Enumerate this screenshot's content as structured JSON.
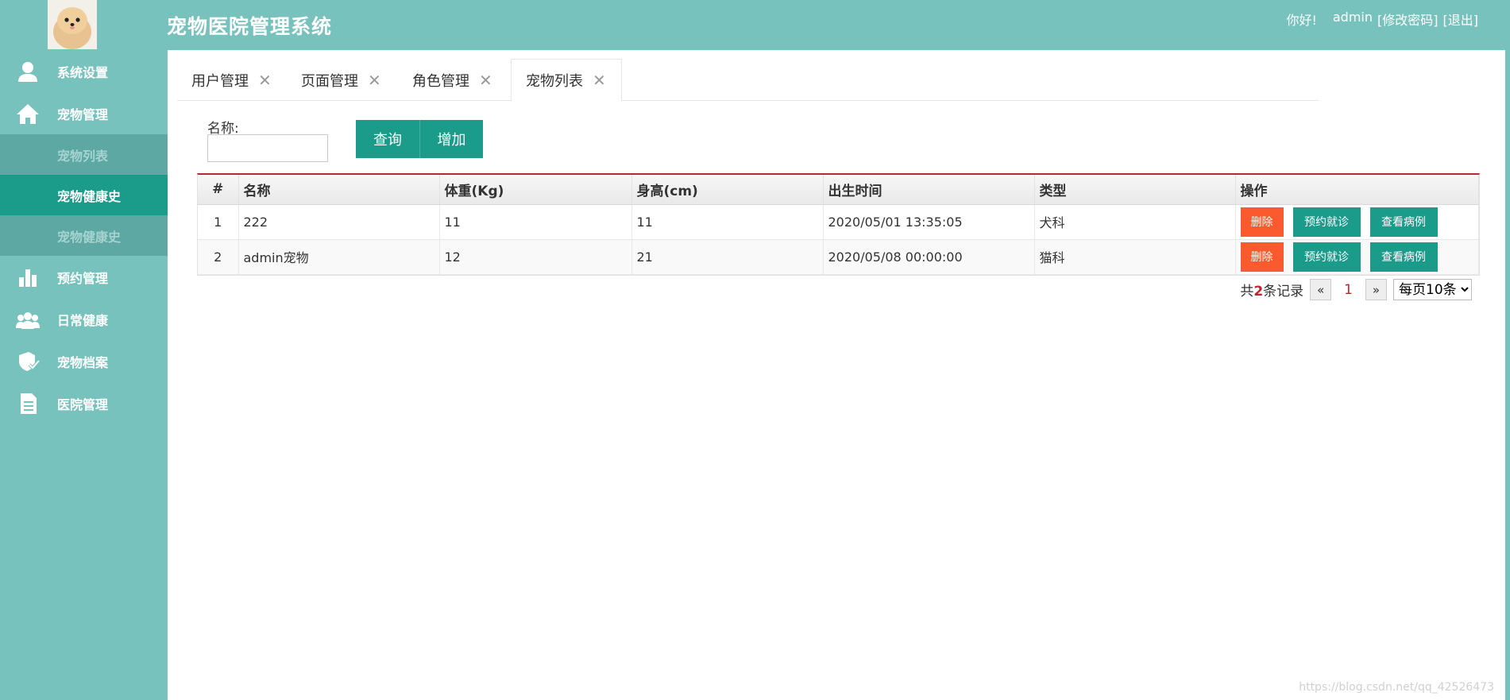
{
  "header": {
    "title": "宠物医院管理系统",
    "greeting": "你好!",
    "username": "admin",
    "change_password": "[修改密码]",
    "logout": "[退出]"
  },
  "sidebar": {
    "items": [
      {
        "label": "系统设置",
        "icon": "user-icon"
      },
      {
        "label": "宠物管理",
        "icon": "home-icon"
      },
      {
        "label": "宠物列表",
        "state": "faded"
      },
      {
        "label": "宠物健康史",
        "state": "active"
      },
      {
        "label": "宠物健康史",
        "state": "faded"
      },
      {
        "label": "预约管理",
        "icon": "bar-chart-icon"
      },
      {
        "label": "日常健康",
        "icon": "group-icon"
      },
      {
        "label": "宠物档案",
        "icon": "badge-check-icon"
      },
      {
        "label": "医院管理",
        "icon": "document-icon"
      }
    ]
  },
  "tabs": [
    {
      "label": "用户管理"
    },
    {
      "label": "页面管理"
    },
    {
      "label": "角色管理"
    },
    {
      "label": "宠物列表",
      "active": true
    }
  ],
  "search": {
    "label": "名称:",
    "value": "",
    "query_button": "查询",
    "add_button": "增加"
  },
  "table": {
    "headers": [
      "#",
      "名称",
      "体重(Kg)",
      "身高(cm)",
      "出生时间",
      "类型",
      "操作"
    ],
    "rows": [
      {
        "num": "1",
        "name": "222",
        "weight": "11",
        "height": "11",
        "birth": "2020/05/01 13:35:05",
        "type": "犬科"
      },
      {
        "num": "2",
        "name": "admin宠物",
        "weight": "12",
        "height": "21",
        "birth": "2020/05/08 00:00:00",
        "type": "猫科"
      }
    ],
    "actions": {
      "delete": "删除",
      "book": "预约就诊",
      "cases": "查看病例"
    }
  },
  "pager": {
    "prefix": "共",
    "total": "2",
    "suffix": "条记录",
    "prev": "«",
    "page": "1",
    "next": "»",
    "page_size": "每页10条"
  },
  "watermark": "https://blog.csdn.net/qq_42526473",
  "colors": {
    "teal": "#78c2bd",
    "dark_teal": "#1b9b8a",
    "danger": "#fa5a2e",
    "accent_red": "#c0232b"
  }
}
